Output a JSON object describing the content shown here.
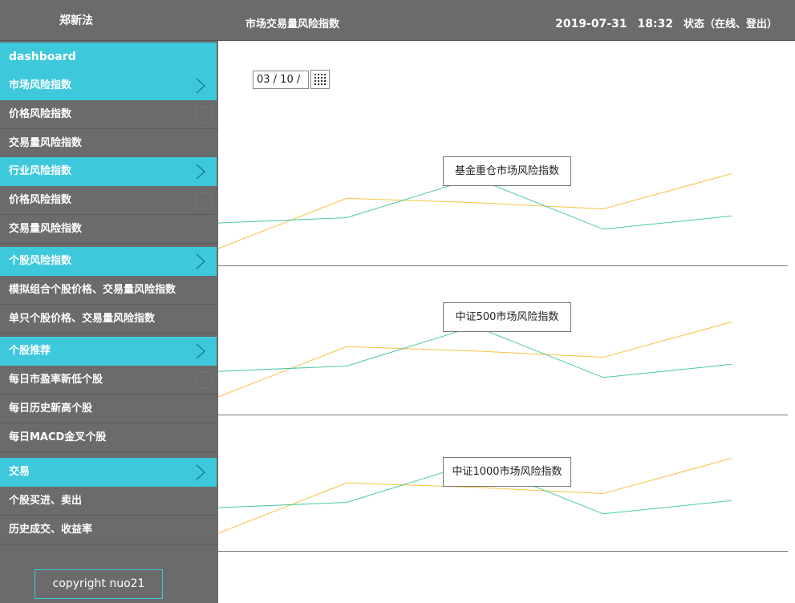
{
  "topbar": {
    "user": "郑新法",
    "title": "市场交易量风险指数",
    "date": "2019-07-31",
    "time": "18:32",
    "status": "状态（在线、登出）"
  },
  "sidebar": {
    "dashboard": "dashboard",
    "groups": [
      {
        "label": "市场风险指数",
        "items": [
          "价格风险指数",
          "交易量风险指数"
        ]
      },
      {
        "label": "行业风险指数",
        "items": [
          "价格风险指数",
          "交易量风险指数"
        ]
      },
      {
        "label": "个股风险指数",
        "items": [
          "模拟组合个股价格、交易量风险指数",
          "单只个股价格、交易量风险指数"
        ]
      },
      {
        "label": "个股推荐",
        "items": [
          "每日市盈率新低个股",
          "每日历史新高个股",
          "每日MACD金叉个股"
        ]
      },
      {
        "label": "交易",
        "items": [
          "个股买进、卖出",
          "历史成交、收益率"
        ]
      }
    ],
    "copyright": "copyright nuo21"
  },
  "date_input": {
    "value": "03 / 10 /"
  },
  "colors": {
    "accent": "#3ec8dc",
    "sidebar_bg": "#6b6b6b",
    "line_orange": "#f5c242",
    "line_green": "#4cc9a0"
  },
  "chart_data": [
    {
      "type": "line",
      "title": "基金重仓市场风险指数",
      "series": [
        {
          "values": [
            0,
            57,
            52,
            45,
            85
          ]
        },
        {
          "values": [
            29,
            35,
            80,
            22,
            37
          ]
        }
      ]
    },
    {
      "type": "line",
      "title": "中证500市场风险指数",
      "series": [
        {
          "values": [
            0,
            57,
            52,
            45,
            85
          ]
        },
        {
          "values": [
            29,
            35,
            80,
            22,
            37
          ]
        }
      ]
    },
    {
      "type": "line",
      "title": "中证1000市场风险指数",
      "series": [
        {
          "values": [
            0,
            57,
            52,
            45,
            85
          ]
        },
        {
          "values": [
            29,
            35,
            80,
            22,
            37
          ]
        }
      ]
    }
  ]
}
